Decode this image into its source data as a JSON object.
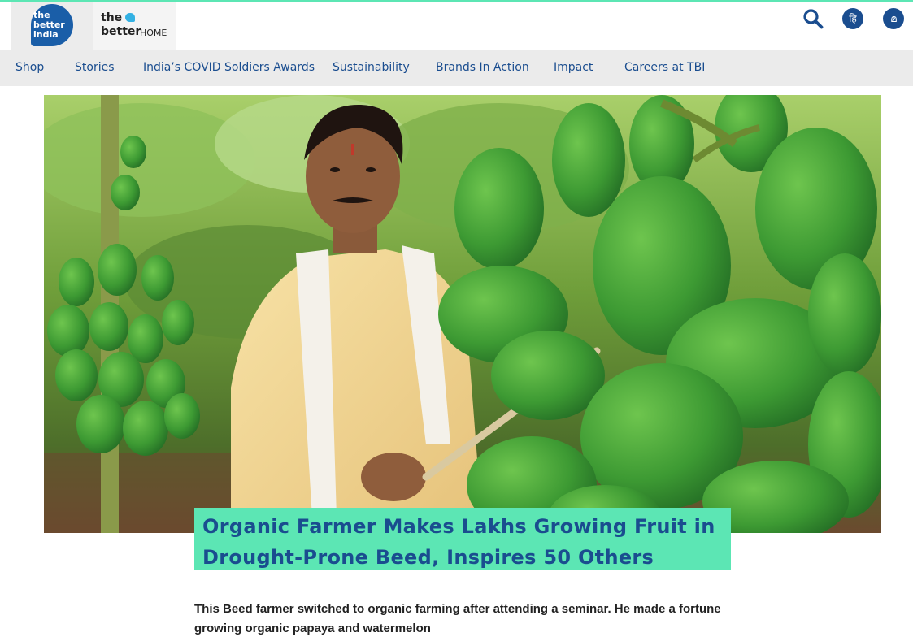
{
  "header": {
    "logo_tbi_lines": [
      "the",
      "better",
      "india"
    ],
    "logo_home": {
      "the": "the",
      "better": "better",
      "home": "HOME"
    },
    "icons": {
      "search": "search-icon",
      "hindi": "हि",
      "malayalam": "മ"
    }
  },
  "nav": {
    "items": [
      {
        "label": "Shop"
      },
      {
        "label": "Stories"
      },
      {
        "label": "India’s COVID Soldiers Awards"
      },
      {
        "label": "Sustainability"
      },
      {
        "label": "Brands In Action"
      },
      {
        "label": "Impact"
      },
      {
        "label": "Careers at TBI"
      }
    ]
  },
  "article": {
    "title": "Organic Farmer Makes Lakhs Growing Fruit in Drought-Prone Beed, Inspires 50 Others",
    "subtitle": "This Beed farmer switched to organic farming after attending a seminar. He made a fortune growing organic papaya and watermelon"
  },
  "colors": {
    "brand_blue": "#1a4d8f",
    "accent_mint": "#5ce6b4",
    "nav_bg": "#ebebeb"
  }
}
